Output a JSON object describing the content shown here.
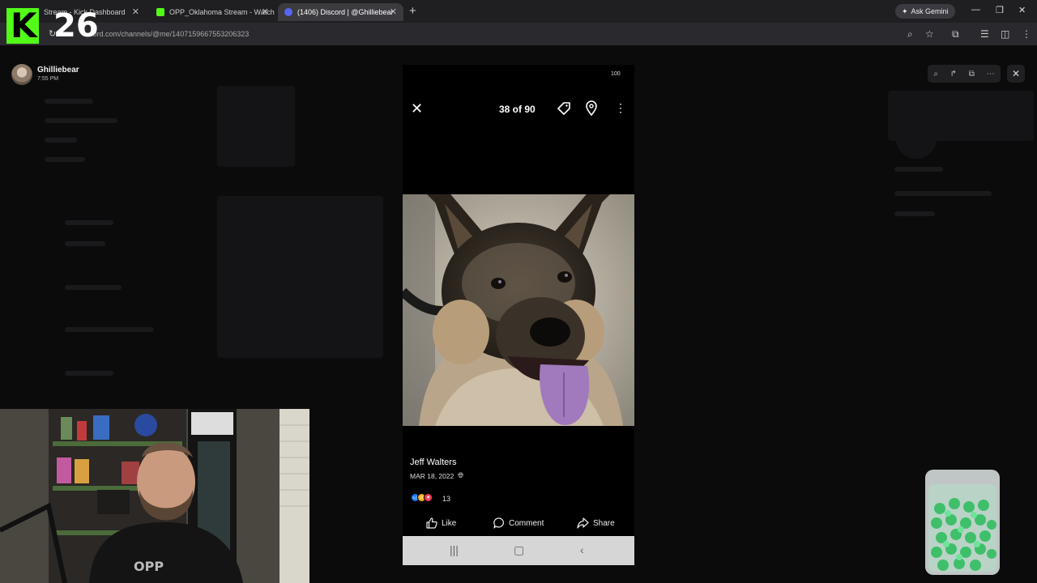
{
  "browser": {
    "tabs": [
      {
        "label": "Stream - Kick Dashboard",
        "favicon_color": "#2e6a1a",
        "active": false
      },
      {
        "label": "OPP_Oklahoma Stream - Watch",
        "favicon_color": "#53fc18",
        "active": false
      },
      {
        "label": "(1406) Discord | @Ghilliebear",
        "favicon_color": "#5865f2",
        "active": true
      }
    ],
    "new_tab": "+",
    "gemini_label": "Ask Gemini",
    "url": "cord.com/channels/@me/1407159667553206323"
  },
  "overlay": {
    "kick_letter": "K",
    "kick_number": "26"
  },
  "discord": {
    "user_name": "Ghilliebear",
    "user_time": "7:55 PM"
  },
  "viewer": {
    "battery": "100",
    "counter": "38 of 90",
    "poster_name": "Jeff Walters",
    "post_date": "MAR 18, 2022",
    "reaction_count": "13",
    "actions": {
      "like": "Like",
      "comment": "Comment",
      "share": "Share"
    }
  },
  "colors": {
    "kick_green": "#53fc18",
    "discord_blurple": "#5865f2"
  },
  "icons": [
    "close-icon",
    "tag-icon",
    "location-pin-icon",
    "more-vert-icon",
    "globe-icon",
    "like-icon",
    "comment-icon",
    "share-icon"
  ]
}
